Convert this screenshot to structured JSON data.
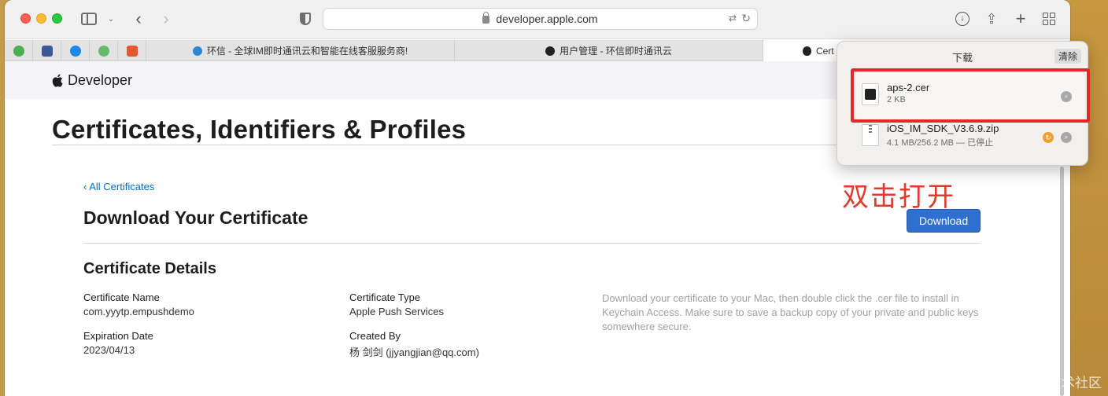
{
  "browser": {
    "url": "developer.apple.com",
    "tabs": [
      {
        "label": "环信 - 全球IM即时通讯云和智能在线客服服务商!"
      },
      {
        "label": "用户管理 - 环信即时通讯云"
      },
      {
        "label": "Cert"
      }
    ]
  },
  "header": {
    "brand": "Developer"
  },
  "page": {
    "title": "Certificates, Identifiers & Profiles",
    "back_link": "‹ All Certificates",
    "section_title": "Download Your Certificate",
    "download_button": "Download",
    "details_title": "Certificate Details",
    "fields": {
      "cert_name_label": "Certificate Name",
      "cert_name_value": "com.yyytp.empushdemo",
      "cert_type_label": "Certificate Type",
      "cert_type_value": "Apple Push Services",
      "expiration_label": "Expiration Date",
      "expiration_value": "2023/04/13",
      "created_by_label": "Created By",
      "created_by_value": "杨 剑剑 (jjyangjian@qq.com)"
    },
    "info_text": "Download your certificate to your Mac, then double click the .cer file to install in Keychain Access. Make sure to save a backup copy of your private and public keys somewhere secure."
  },
  "downloads": {
    "title": "下载",
    "clear_label": "清除",
    "items": [
      {
        "name": "aps-2.cer",
        "meta": "2 KB"
      },
      {
        "name": "iOS_IM_SDK_V3.6.9.zip",
        "meta": "4.1 MB/256.2 MB — 已停止"
      }
    ]
  },
  "annotation": "双击打开",
  "watermark": "@稀土掘金技术社区",
  "colors": {
    "link": "#0070c9",
    "button": "#2f6fd0",
    "annotation": "#e03a2f"
  }
}
